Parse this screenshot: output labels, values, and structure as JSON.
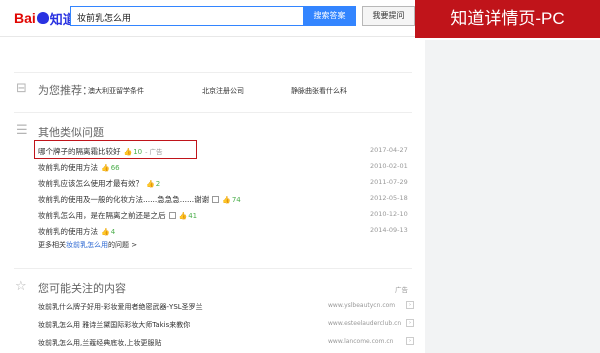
{
  "header": {
    "logo_bai": "Bai",
    "logo_zhidao": "知道",
    "search_value": "妆前乳怎么用",
    "search_button": "搜索答案",
    "ask_button": "我要提问"
  },
  "badge": {
    "label": "知道详情页-PC"
  },
  "recommend": {
    "title": "为您推荐：",
    "items": [
      "澳大利亚留学条件",
      "北京注册公司",
      "静脉曲张看什么科"
    ]
  },
  "similar": {
    "title": "其他类似问题",
    "questions": [
      {
        "title": "哪个牌子的隔离霜比较好",
        "votes": "10",
        "ad": "- 广告",
        "date": "2017-04-27"
      },
      {
        "title": "妆前乳的使用方法",
        "votes": "66",
        "date": "2010-02-01"
      },
      {
        "title": "妆前乳应该怎么使用才最有效？",
        "votes": "2",
        "date": "2011-07-29"
      },
      {
        "title": "妆前乳的使用及一般的化妆方法......急急急......谢谢",
        "votes": "74",
        "date": "2012-05-18"
      },
      {
        "title": "妆前乳怎么用，是在隔离之前还是之后",
        "votes": "41",
        "date": "2010-12-10"
      },
      {
        "title": "妆前乳的使用方法",
        "votes": "4",
        "date": "2014-09-13"
      }
    ],
    "more_prefix": "更多相关",
    "more_link": "妆前乳怎么用",
    "more_suffix": "的问题 >"
  },
  "maybe": {
    "title": "您可能关注的内容",
    "ad_tag": "广告",
    "items": [
      {
        "title": "妆前乳什么牌子好用-彩妆爱用者绝密武器-YSL圣罗兰",
        "url": "www.yslbeautycn.com"
      },
      {
        "title": "妆前乳怎么用 雅诗兰黛国际彩妆大师Takis来教你",
        "url": "www.esteelauderclub.cn"
      },
      {
        "title": "妆前乳怎么用,兰蔻经典底妆,上妆更服贴",
        "url": "www.lancome.com.cn"
      }
    ]
  },
  "icons": {
    "recommend": "list-icon",
    "similar": "menu-lines-icon",
    "maybe": "star-icon",
    "thumb": "thumb-up-icon",
    "tag": "tag-icon"
  },
  "colors": {
    "brand_red": "#c0141a",
    "brand_blue": "#3385ff",
    "link_blue": "#2f6ad3",
    "vote_green": "#4cae4c"
  }
}
